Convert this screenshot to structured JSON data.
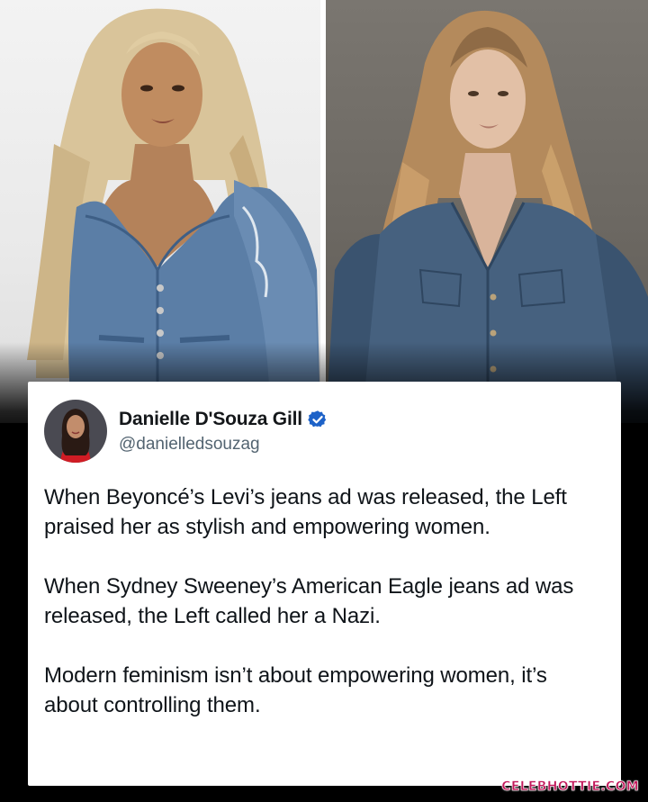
{
  "post": {
    "author": {
      "display_name": "Danielle D'Souza Gill",
      "handle": "@danielledsouzag",
      "verified": true,
      "verified_color": "#1d9bf0"
    },
    "paragraphs": [
      "When Beyoncé’s Levi’s jeans ad was released, the Left praised her as stylish and empowering women.",
      "When Sydney Sweeney’s American Eagle jeans ad was released, the Left called her a Nazi.",
      "Modern feminism isn’t about empowering women, it’s about controlling them."
    ]
  },
  "photos": {
    "left": {
      "icon": "woman-in-denim-photo",
      "background": "#ececec"
    },
    "right": {
      "icon": "woman-in-denim-jacket-photo",
      "background": "#6f6b65"
    }
  },
  "watermark": {
    "text": "CELEBHOTTIE.COM",
    "color": "#c2185b"
  }
}
